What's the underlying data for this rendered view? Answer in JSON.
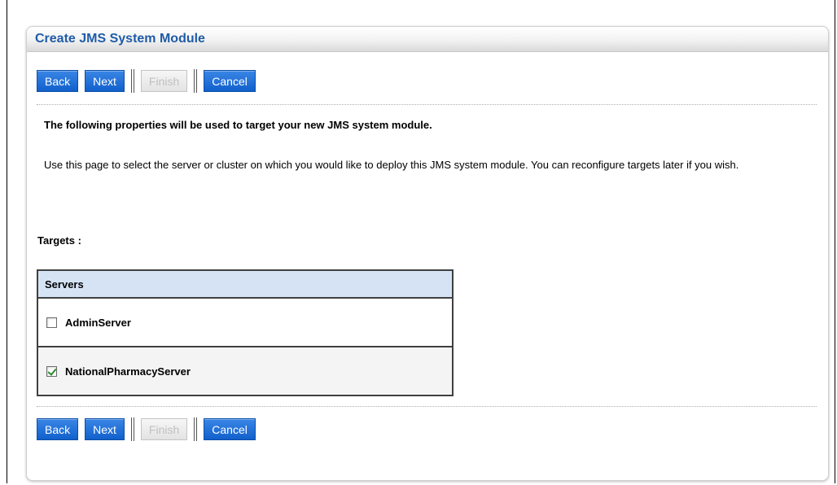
{
  "panel": {
    "title": "Create JMS System Module"
  },
  "buttons": {
    "back": "Back",
    "next": "Next",
    "finish": "Finish",
    "cancel": "Cancel"
  },
  "content": {
    "intro": "The following properties will be used to target your new JMS system module.",
    "description": "Use this page to select the server or cluster on which you would like to deploy this JMS system module. You can reconfigure targets later if you wish.",
    "targets_label": "Targets :"
  },
  "servers": {
    "header": "Servers",
    "items": [
      {
        "label": "AdminServer",
        "checked": false
      },
      {
        "label": "NationalPharmacyServer",
        "checked": true
      }
    ]
  }
}
